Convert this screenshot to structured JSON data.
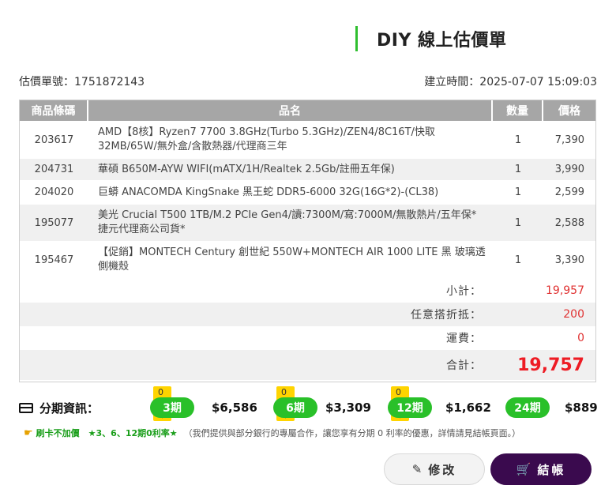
{
  "header": {
    "title": "DIY 線上估價單"
  },
  "meta": {
    "quote_no": "估價單號：1751872143",
    "created": "建立時間：2025-07-07 15:09:03"
  },
  "table": {
    "headers": [
      "商品條碼",
      "品名",
      "數量",
      "價格"
    ],
    "rows": [
      {
        "code": "203617",
        "name": "AMD【8核】Ryzen7 7700 3.8GHz(Turbo 5.3GHz)/ZEN4/8C16T/快取32MB/65W/無外盒/含散熱器/代理商三年",
        "qty": "1",
        "price": "7,390"
      },
      {
        "code": "204731",
        "name": "華碩 B650M-AYW WIFI(mATX/1H/Realtek 2.5Gb/註冊五年保)",
        "qty": "1",
        "price": "3,990"
      },
      {
        "code": "204020",
        "name": "巨蟒 ANACOMDA KingSnake 黑王蛇 DDR5-6000 32G(16G*2)-(CL38)",
        "qty": "1",
        "price": "2,599"
      },
      {
        "code": "195077",
        "name": "美光 Crucial T500 1TB/M.2 PCIe Gen4/讀:7300M/寫:7000M/無散熱片/五年保*捷元代理商公司貨*",
        "qty": "1",
        "price": "2,588"
      },
      {
        "code": "195467",
        "name": "【促銷】MONTECH Century 創世紀 550W+MONTECH AIR 1000 LITE 黑 玻璃透側機殼",
        "qty": "1",
        "price": "3,390"
      }
    ]
  },
  "summary": {
    "subtotal_label": "小計：",
    "subtotal": "19,957",
    "discount_label": "任意搭折抵：",
    "discount": "200",
    "shipping_label": "運費：",
    "shipping": "0",
    "total_label": "合計：",
    "total": "19,757"
  },
  "installments": {
    "label": "分期資訊：",
    "zero_tag": "0利率",
    "plans": [
      {
        "term": "3期",
        "amount": "$6,586"
      },
      {
        "term": "6期",
        "amount": "$3,309"
      },
      {
        "term": "12期",
        "amount": "$1,662"
      },
      {
        "term": "24期",
        "amount": "$889"
      }
    ]
  },
  "note": {
    "highlight": "刷卡不加價　★3、6、12期0利率★",
    "text": "（我們提供與部分銀行的專屬合作，讓您享有分期 0 利率的優惠，詳情請見結帳頁面。）"
  },
  "buttons": {
    "edit": "修改",
    "checkout": "結帳"
  },
  "colors": {
    "accent_green": "#29c029",
    "price_red": "#ee1c24",
    "checkout_bg": "#3a0a4e",
    "zero_tag": "#ffd400"
  }
}
